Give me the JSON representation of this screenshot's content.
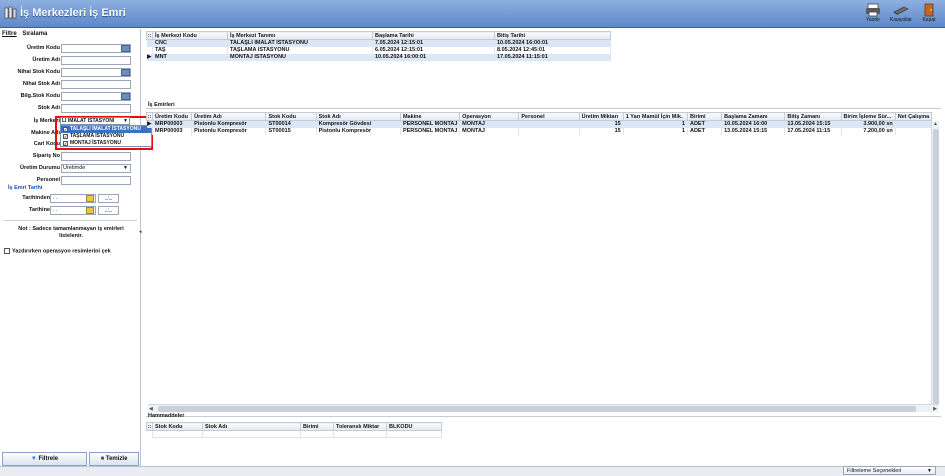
{
  "window": {
    "title": "İş Merkezleri İş Emri"
  },
  "toolbar": {
    "print_label": "Yazdır",
    "shortcuts_label": "Kısayollar",
    "close_label": "Kapat"
  },
  "filter": {
    "tabs": [
      "Filtre",
      "Sıralama"
    ],
    "fields": {
      "uretim_kodu": "Üretim Kodu",
      "uretim_adi": "Üretim Adı",
      "nihai_stok_kodu": "Nihai Stok Kodu",
      "nihai_stok_adi": "Nihai Stok Adı",
      "bilg_stok_kodu": "Bilg.Stok Kodu",
      "stok_adi": "Stok Adı",
      "is_merkezi": "İş Merkezi",
      "makine_adi": "Makine Adı",
      "cari_kodu": "Cari Kodu",
      "siparis_no": "Sipariş No",
      "uretim_durumu": "Üretim Durumu",
      "uretim_durumu_value": "Üretimde",
      "personel": "Personel"
    },
    "is_emri_tarihi": "İş Emri Tarihi",
    "tarihinden": "Tarihinden",
    "tarihine": "Tarihine",
    "date_placeholder": ". .",
    "time_placeholder": "_:_",
    "note": "Not : Sadece tamamlanmayan iş emirleri listelenir.",
    "print_ops_label": "Yazdırırken operasyon resimlerini çek",
    "filter_button": "Filtrele",
    "clear_button": "Temizle"
  },
  "dropdown": {
    "combo_text": "LI İMALAT İSTASYONI",
    "items": [
      {
        "label": "TALAŞLI İMALAT İSTASYONU",
        "checked": true,
        "selected": true
      },
      {
        "label": "TAŞLAMA İSTASYONU",
        "checked": true,
        "selected": false
      },
      {
        "label": "MONTAJ İSTASYONU",
        "checked": true,
        "selected": false
      }
    ]
  },
  "centers": {
    "columns": [
      "İş Merkezi Kodu",
      "İş Merkezi Tanımı",
      "Başlama Tarihi",
      "Bitiş Tarihi"
    ],
    "rows": [
      {
        "kodu": "CNC",
        "tanimi": "TALAŞLI İMALAT İSTASYONU",
        "baslama": "7.05.2024 12:15:01",
        "bitis": "10.05.2024 16:00:01"
      },
      {
        "kodu": "TAŞ",
        "tanimi": "TAŞLAMA İSTASYONU",
        "baslama": "6.05.2024 12:15:01",
        "bitis": "8.05.2024 12:45:01"
      },
      {
        "kodu": "MNT",
        "tanimi": "MONTAJ İSTASYONU",
        "baslama": "10.05.2024 16:00:01",
        "bitis": "17.05.2024 11:15:01"
      }
    ]
  },
  "orders": {
    "title": "İş Emirleri",
    "columns": [
      "Üretim Kodu",
      "Üretim Adı",
      "Stok Kodu",
      "Stok Adı",
      "Makine",
      "Operasyon",
      "Personel",
      "Üretim Miktarı",
      "1 Yarı Mamül İçin Mik.",
      "Birimi",
      "Başlama Zamanı",
      "Bitiş Zamanı",
      "Birim İşleme Sür...",
      "Net Çalışma"
    ],
    "rows": [
      {
        "uretim_kodu": "MRP00003",
        "uretim_adi": "Pistonlu Kompresör",
        "stok_kodu": "ST00014",
        "stok_adi": "Kompresör Gövdesi",
        "makine": "PERSONEL MONTAJ",
        "operasyon": "MONTAJ",
        "personel": "",
        "miktar": "15",
        "yari_mamul": "1",
        "birimi": "ADET",
        "baslama": "10.05.2024 16:00",
        "bitis": "13.05.2024 15:15",
        "birim_sure": "3.900,00 sn",
        "net": ""
      },
      {
        "uretim_kodu": "MRP00003",
        "uretim_adi": "Pistonlu Kompresör",
        "stok_kodu": "ST00015",
        "stok_adi": "Pistonlu Kompresör",
        "makine": "PERSONEL MONTAJ",
        "operasyon": "MONTAJ",
        "personel": "",
        "miktar": "15",
        "yari_mamul": "1",
        "birimi": "ADET",
        "baslama": "13.05.2024 15:15",
        "bitis": "17.05.2024 11:15",
        "birim_sure": "7.200,00 sn",
        "net": ""
      }
    ]
  },
  "materials": {
    "title": "Hammaddeler",
    "columns": [
      "Stok Kodu",
      "Stok Adı",
      "Birimi",
      "Toleranslı Miktar",
      "BLKODU"
    ]
  },
  "status": {
    "settings_button": "Filtreleme Seçenekleri"
  },
  "colors": {
    "title_bar": "#5f88c8",
    "row_highlight": "#dbe7f7",
    "dropdown_outline": "#e01010",
    "selected_item": "#3d6fc2"
  }
}
